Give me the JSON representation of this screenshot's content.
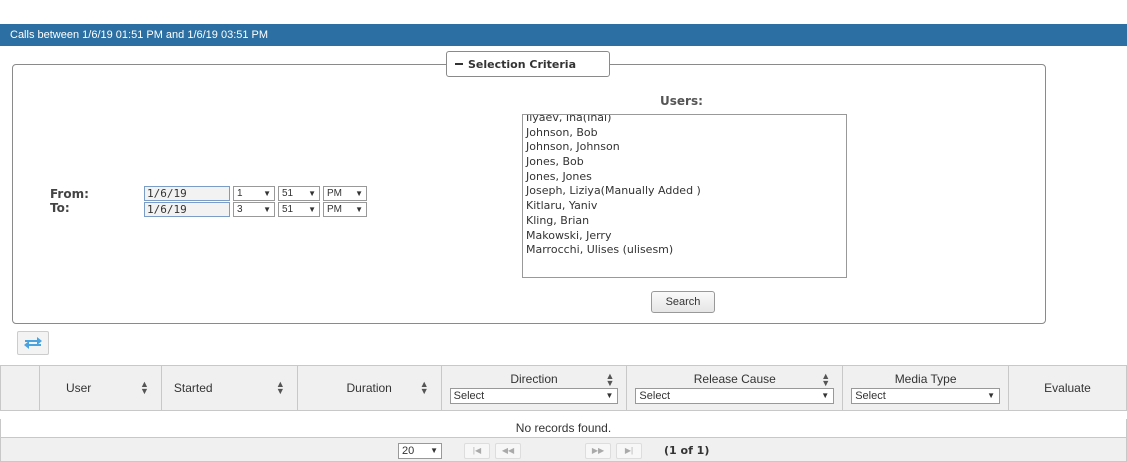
{
  "header": {
    "title": "Calls between 1/6/19 01:51 PM and 1/6/19 03:51 PM"
  },
  "criteria": {
    "legend": "Selection Criteria",
    "from": {
      "label": "From:",
      "date": "1/6/19",
      "hour": "1",
      "minute": "51",
      "ampm": "PM"
    },
    "to": {
      "label": "To:",
      "date": "1/6/19",
      "hour": "3",
      "minute": "51",
      "ampm": "PM"
    },
    "users_title": "Users:",
    "users": [
      "Ilyaev, Ina(Inai)",
      "Johnson, Bob",
      "Johnson, Johnson",
      "Jones, Bob",
      "Jones, Jones",
      "Joseph, Liziya(Manually Added )",
      "Kitlaru, Yaniv",
      "Kling, Brian",
      "Makowski, Jerry",
      "Marrocchi, Ulises (ulisesm)"
    ],
    "search_label": "Search"
  },
  "grid": {
    "columns": {
      "user": "User",
      "started": "Started",
      "duration": "Duration",
      "direction": "Direction",
      "release_cause": "Release Cause",
      "media_type": "Media Type",
      "evaluate": "Evaluate"
    },
    "filter_placeholder": "Select",
    "empty_message": "No records found."
  },
  "pager": {
    "page_size": "20",
    "page_info": "(1 of 1)"
  },
  "colors": {
    "header_bar": "#2c6fa2",
    "swap_icon": "#4aa3df"
  }
}
